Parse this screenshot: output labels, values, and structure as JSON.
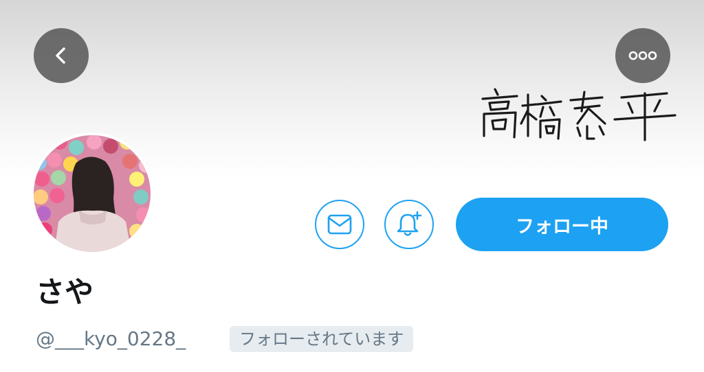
{
  "header": {
    "banner_text": "高橋恭平",
    "back_icon": "chevron-left-icon",
    "more_icon": "more-horizontal-icon"
  },
  "profile": {
    "display_name": "さや",
    "username": "@___kyo_0228_",
    "follows_you_badge": "フォローされています"
  },
  "actions": {
    "message_icon": "envelope-icon",
    "notify_icon": "bell-plus-icon",
    "follow_label": "フォロー中"
  },
  "colors": {
    "accent": "#1da1f2",
    "text_primary": "#14171a",
    "text_secondary": "#657786",
    "badge_bg": "#e6ecf0"
  }
}
